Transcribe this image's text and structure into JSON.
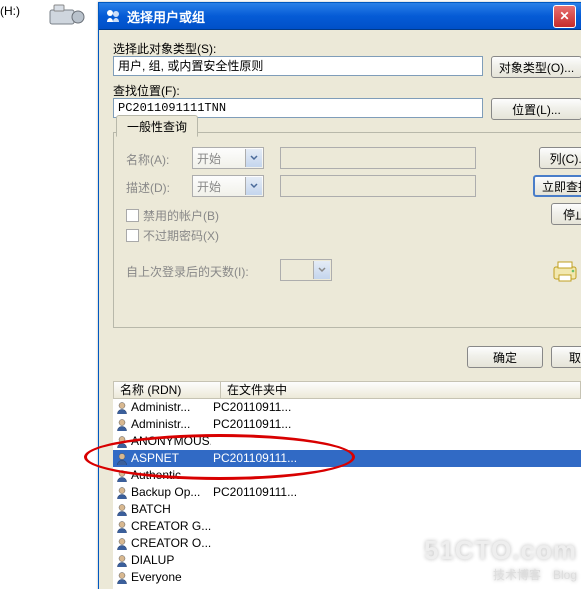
{
  "desktop": {
    "drive_label": "(H:)"
  },
  "dialog": {
    "title": "选择用户或组",
    "object_types_label": "选择此对象类型(S):",
    "object_types_value": "用户, 组, 或内置安全性原则",
    "object_types_button": "对象类型(O)...",
    "location_label": "查找位置(F):",
    "location_value": "PC2011091111TNN",
    "location_button": "位置(L)...",
    "ok_button": "确定",
    "cancel_button": "取消"
  },
  "query": {
    "tab_label": "一般性查询",
    "name_label": "名称(A):",
    "name_mode": "开始",
    "desc_label": "描述(D):",
    "desc_mode": "开始",
    "disabled_accounts": "禁用的帐户(B)",
    "non_expiring_pw": "不过期密码(X)",
    "days_since_login": "自上次登录后的天数(I):",
    "columns_button": "列(C)...",
    "find_now_button": "立即查找",
    "stop_button": "停止"
  },
  "results": {
    "col1": "名称 (RDN)",
    "col2": "在文件夹中",
    "rows": [
      {
        "name": "Administr...",
        "folder": "PC20110911..."
      },
      {
        "name": "Administr...",
        "folder": "PC20110911..."
      },
      {
        "name": "ANONYMOUS...",
        "folder": ""
      },
      {
        "name": "ASPNET",
        "folder": "PC201109111...",
        "selected": true
      },
      {
        "name": "Authentic...",
        "folder": ""
      },
      {
        "name": "Backup Op...",
        "folder": "PC201109111..."
      },
      {
        "name": "BATCH",
        "folder": ""
      },
      {
        "name": "CREATOR G...",
        "folder": ""
      },
      {
        "name": "CREATOR O...",
        "folder": ""
      },
      {
        "name": "DIALUP",
        "folder": ""
      },
      {
        "name": "Everyone",
        "folder": ""
      }
    ]
  },
  "watermark": {
    "big": "51CTO.com",
    "small": "技术博客　Blog"
  }
}
